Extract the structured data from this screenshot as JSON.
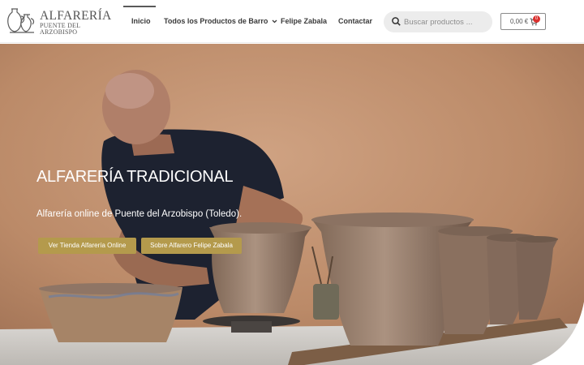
{
  "logo": {
    "title": "ALFARERÍA",
    "subtitle_line1": "PUENTE DEL",
    "subtitle_line2": "ARZOBISPO"
  },
  "nav": {
    "items": [
      {
        "label": "Inicio",
        "active": true
      },
      {
        "label": "Todos los Productos de Barro",
        "has_dropdown": true
      },
      {
        "label": "Felipe Zabala"
      },
      {
        "label": "Contactar"
      }
    ]
  },
  "search": {
    "placeholder": "Buscar productos ..."
  },
  "cart": {
    "amount": "0,00 €",
    "count": "0"
  },
  "hero": {
    "title": "ALFARERÍA TRADICIONAL",
    "subtitle": "Alfarería online de Puente del Arzobispo (Toledo).",
    "buttons": [
      {
        "label": "Ver Tienda Alfarería Online"
      },
      {
        "label": "Sobre Alfarero Felipe Zabala"
      }
    ]
  },
  "colors": {
    "accent_button": "#b49a4c",
    "cart_badge": "#d9302e",
    "hero_wall": "#c1906f"
  },
  "icons": [
    "jug-logo-icon",
    "search-icon",
    "cart-icon",
    "chevron-down-icon"
  ]
}
